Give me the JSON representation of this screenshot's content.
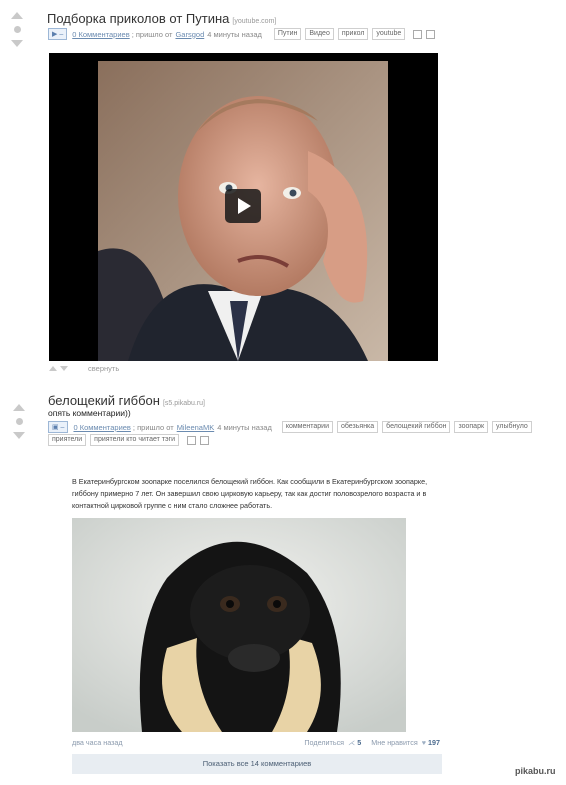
{
  "post1": {
    "title": "Подборка приколов от Путина",
    "source": "[youtube.com]",
    "control_label": "▶ –",
    "comments_link": "0 Комментариев",
    "came_from": "; пришло от",
    "author": "Garsgod",
    "time": "4 минуты назад",
    "tags": [
      "Путин",
      "Видео",
      "прикол",
      "youtube"
    ],
    "collapse_label": "свернуть"
  },
  "post2": {
    "title": "белощекий гиббон",
    "source": "[s5.pikabu.ru]",
    "subtitle": "опять комментарии))",
    "control_label": "▣ –",
    "comments_link": "0 Комментариев",
    "came_from": "; пришло от",
    "author": "MileenaMK",
    "time": "4 минуты назад",
    "tags": [
      "комментарии",
      "обезьянка",
      "белощекий гиббон",
      "зоопарк",
      "улыбнуло",
      "приятели",
      "приятели кто читает тэги"
    ]
  },
  "card": {
    "text": "В Екатеринбургском зоопарке поселился белощекий гиббон. Как сообщили в Екатеринбургском зоопарке, гиббону примерно 7 лет. Он завершил свою цирковую карьеру, так как достиг половозрелого возраста и в контактной цирковой группе с ним стало сложнее работать.",
    "time": "два часа назад",
    "share_label": "Поделиться",
    "share_count": "5",
    "like_label": "Мне нравится",
    "like_count": "197",
    "show_comments": "Показать все 14 комментариев"
  },
  "watermark": "pikabu.ru",
  "colors": {
    "link": "#6b8bb0",
    "vote_gray": "#c9c9c9",
    "footer_bg": "#e8edf2"
  },
  "icons": [
    "arrow-up-icon",
    "arrow-down-icon",
    "play-icon",
    "heart-icon",
    "share-icon"
  ]
}
